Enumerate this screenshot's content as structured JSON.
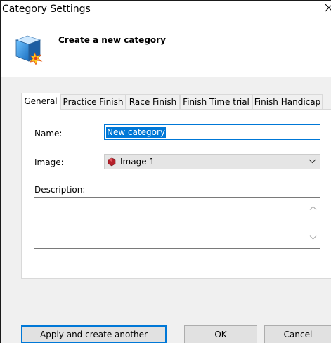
{
  "window": {
    "title": "Category Settings",
    "close_glyph": "✕"
  },
  "header": {
    "subtitle": "Create a new category",
    "icon": "cube-burst-icon"
  },
  "tabs": [
    {
      "label": "General",
      "active": true
    },
    {
      "label": "Practice Finish",
      "active": false
    },
    {
      "label": "Race Finish",
      "active": false
    },
    {
      "label": "Finish Time trial",
      "active": false
    },
    {
      "label": "Finish Handicap",
      "active": false
    }
  ],
  "form": {
    "name_label": "Name:",
    "name_value": "New category",
    "image_label": "Image:",
    "image_value": "Image 1",
    "description_label": "Description:",
    "description_value": ""
  },
  "buttons": {
    "apply_another": "Apply and create another",
    "ok": "OK",
    "cancel": "Cancel"
  },
  "colors": {
    "accent": "#0078d7",
    "gem": "#b5202a"
  }
}
